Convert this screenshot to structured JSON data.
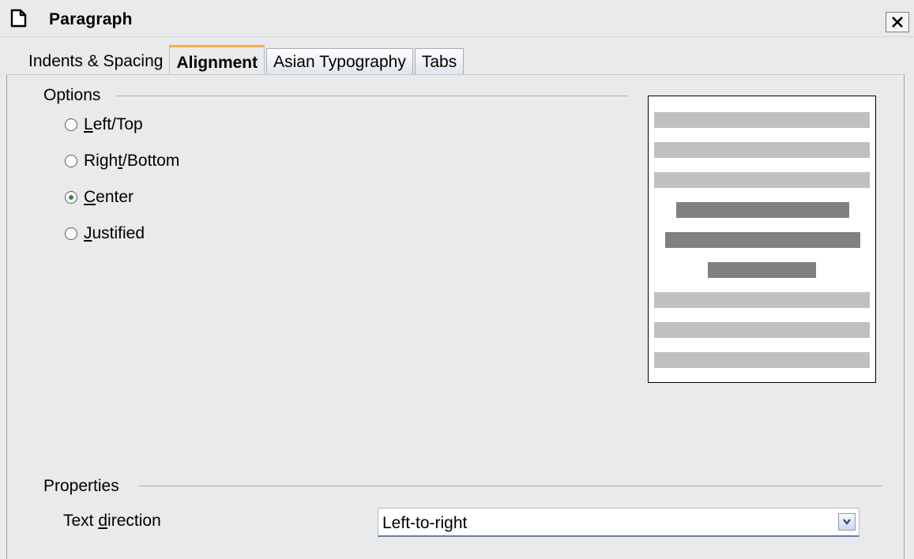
{
  "window": {
    "title": "Paragraph",
    "close_label": "×"
  },
  "tabs": [
    {
      "label": "Indents & Spacing",
      "state": "plain"
    },
    {
      "label": "Alignment",
      "state": "active"
    },
    {
      "label": "Asian Typography",
      "state": "inactive"
    },
    {
      "label": "Tabs",
      "state": "inactive"
    }
  ],
  "options": {
    "heading": "Options",
    "items": [
      {
        "pre": "",
        "mn": "L",
        "post": "eft/Top",
        "checked": false
      },
      {
        "pre": "Righ",
        "mn": "t",
        "post": "/Bottom",
        "checked": false
      },
      {
        "pre": "",
        "mn": "C",
        "post": "enter",
        "checked": true
      },
      {
        "pre": "",
        "mn": "J",
        "post": "ustified",
        "checked": false
      }
    ]
  },
  "preview": {
    "alignment": "center",
    "colors": {
      "context_line": "#c0c0c0",
      "paragraph_line": "#808080"
    }
  },
  "properties": {
    "heading": "Properties",
    "text_direction": {
      "label_pre": "Text ",
      "label_mn": "d",
      "label_post": "irection",
      "value": "Left-to-right"
    }
  },
  "colors": {
    "active_tab_accent": "#f2b14a",
    "radio_checked": "#3a8a3a"
  }
}
